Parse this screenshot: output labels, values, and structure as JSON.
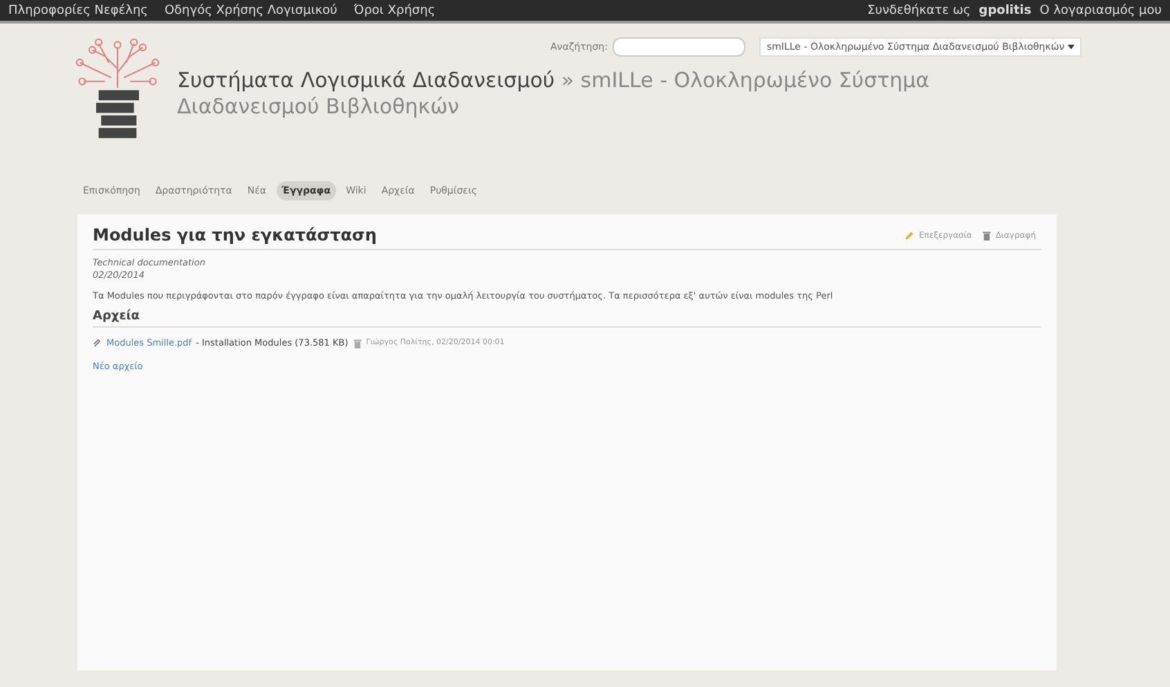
{
  "top_menu": {
    "left": [
      "Πληροφορίες Νεφέλης",
      "Οδηγός Χρήσης Λογισμικού",
      "Όροι Χρήσης"
    ],
    "logged_in_label": "Συνδεθήκατε ως",
    "user": "gpolitis",
    "account": "Ο λογαριασμός μου"
  },
  "header": {
    "search_label": "Αναζήτηση:",
    "project_select": "smILLe - Ολοκληρωμένο Σύστημα Διαδανεισμού Βιβλιοθηκών",
    "parent_project": "Συστήματα Λογισμικά Διαδανεισμού",
    "separator": "»",
    "project_title": "smILLe - Ολοκληρωμένο Σύστημα Διαδανεισμού Βιβλιοθηκών"
  },
  "tabs": [
    {
      "label": "Επισκόπηση",
      "selected": false
    },
    {
      "label": "Δραστηριότητα",
      "selected": false
    },
    {
      "label": "Νέα",
      "selected": false
    },
    {
      "label": "Έγγραφα",
      "selected": true
    },
    {
      "label": "Wiki",
      "selected": false
    },
    {
      "label": "Αρχεία",
      "selected": false
    },
    {
      "label": "Ρυθμίσεις",
      "selected": false
    }
  ],
  "document": {
    "title": "Modules για την εγκατάσταση",
    "actions": [
      {
        "kind": "edit",
        "label": "Επεξεργασία"
      },
      {
        "kind": "delete",
        "label": "Διαγραφή"
      }
    ],
    "category": "Technical documentation",
    "date": "02/20/2014",
    "description": "Τα Modules που περιγράφονται στο παρόν έγγραφο είναι απαραίτητα για την ομαλή λειτουργία του συστήματος. Τα περισσότερα εξ' αυτών είναι modules της Perl",
    "files_heading": "Αρχεία",
    "files": [
      {
        "name": "Modules Smille.pdf",
        "description": "- Installation Modules (73.581 KB)",
        "author_date": "Γιώργος Πολίτης, 02/20/2014 00:01"
      }
    ],
    "new_file": "Νέο αρχείο"
  }
}
